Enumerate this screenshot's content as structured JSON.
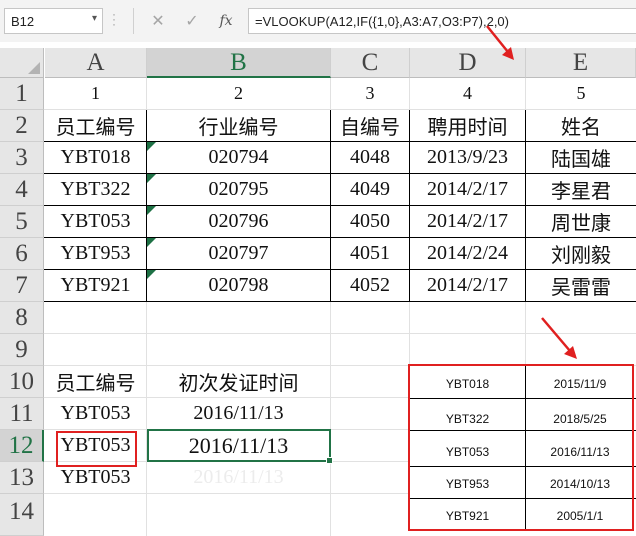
{
  "formula_bar": {
    "name_box": "B12",
    "cancel_glyph": "✕",
    "enter_glyph": "✓",
    "function_label": "fx",
    "formula": "=VLOOKUP(A12,IF({1,0},A3:A7,O3:P7),2,0)"
  },
  "columns": [
    "A",
    "B",
    "C",
    "D",
    "E"
  ],
  "rows": [
    "1",
    "2",
    "3",
    "4",
    "5",
    "6",
    "7",
    "8",
    "9",
    "10",
    "11",
    "12",
    "13",
    "14"
  ],
  "sheet": {
    "row1": [
      "1",
      "2",
      "3",
      "4",
      "5"
    ],
    "headers": [
      "员工编号",
      "行业编号",
      "自编号",
      "聘用时间",
      "姓名"
    ],
    "records": [
      [
        "YBT018",
        "020794",
        "4048",
        "2013/9/23",
        "陆国雄"
      ],
      [
        "YBT322",
        "020795",
        "4049",
        "2014/2/17",
        "李星君"
      ],
      [
        "YBT053",
        "020796",
        "4050",
        "2014/2/17",
        "周世康"
      ],
      [
        "YBT953",
        "020797",
        "4051",
        "2014/2/24",
        "刘刚毅"
      ],
      [
        "YBT921",
        "020798",
        "4052",
        "2014/2/17",
        "吴雷雷"
      ]
    ],
    "lookup": {
      "header_id": "员工编号",
      "header_date": "初次发证时间",
      "row11": [
        "YBT053",
        "2016/11/13"
      ],
      "row12": [
        "YBT053",
        "2016/11/13"
      ],
      "row13": [
        "YBT053",
        "2016/11/13"
      ]
    },
    "side_table": [
      [
        "YBT018",
        "2015/11/9"
      ],
      [
        "YBT322",
        "2018/5/25"
      ],
      [
        "YBT053",
        "2016/11/13"
      ],
      [
        "YBT953",
        "2014/10/13"
      ],
      [
        "YBT921",
        "2005/1/1"
      ]
    ]
  },
  "colors": {
    "accent": "#217346",
    "highlight": "#e02020",
    "comment_marker": "#1e7145"
  }
}
